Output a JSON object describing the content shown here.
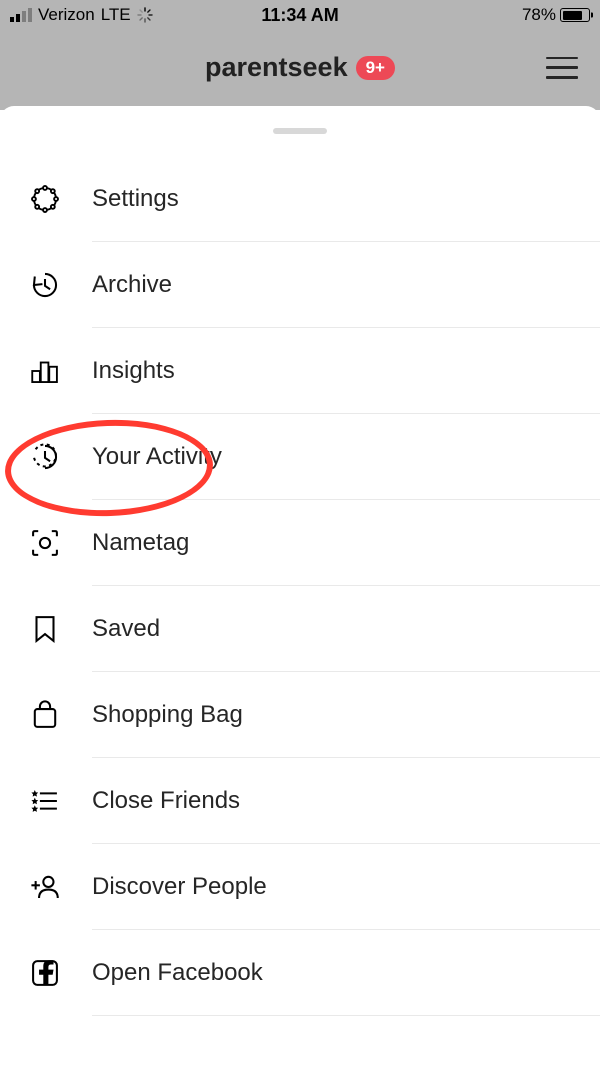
{
  "status_bar": {
    "carrier": "Verizon",
    "network": "LTE",
    "time": "11:34 AM",
    "battery_pct": "78%",
    "battery_fill": 78
  },
  "header": {
    "title": "parentseek",
    "badge": "9+"
  },
  "menu": {
    "items": [
      {
        "id": "settings",
        "label": "Settings",
        "icon": "settings"
      },
      {
        "id": "archive",
        "label": "Archive",
        "icon": "archive"
      },
      {
        "id": "insights",
        "label": "Insights",
        "icon": "insights"
      },
      {
        "id": "your-activity",
        "label": "Your Activity",
        "icon": "activity"
      },
      {
        "id": "nametag",
        "label": "Nametag",
        "icon": "nametag"
      },
      {
        "id": "saved",
        "label": "Saved",
        "icon": "saved"
      },
      {
        "id": "shopping-bag",
        "label": "Shopping Bag",
        "icon": "bag"
      },
      {
        "id": "close-friends",
        "label": "Close Friends",
        "icon": "friends"
      },
      {
        "id": "discover-people",
        "label": "Discover People",
        "icon": "discover"
      },
      {
        "id": "open-facebook",
        "label": "Open Facebook",
        "icon": "facebook"
      }
    ]
  },
  "annotation": {
    "highlighted_item": "insights",
    "highlight_color": "#ff3b30"
  }
}
